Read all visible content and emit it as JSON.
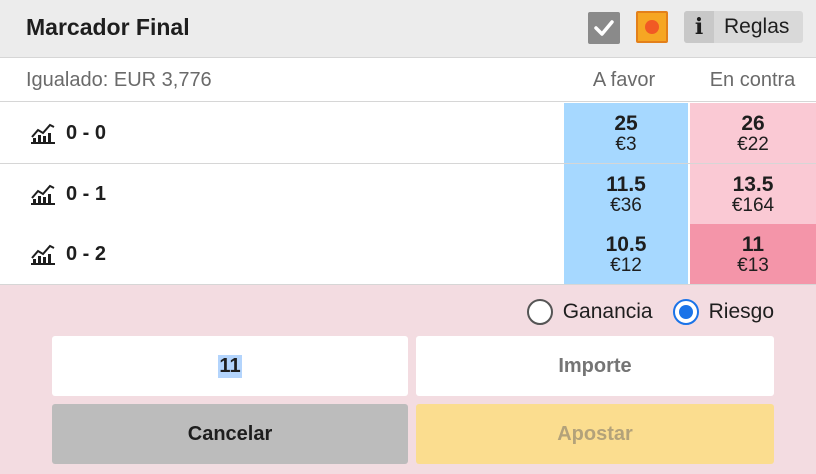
{
  "market": {
    "title": "Marcador Final",
    "rules_label": "Reglas",
    "info_label": "i"
  },
  "summary": {
    "matched": "Igualado: EUR 3,776",
    "back_header": "A favor",
    "lay_header": "En contra"
  },
  "runners": [
    {
      "name": "0 - 0",
      "back_odds": "25",
      "back_stake": "€3",
      "lay_odds": "26",
      "lay_stake": "€22"
    },
    {
      "name": "0 - 1",
      "back_odds": "11.5",
      "back_stake": "€36",
      "lay_odds": "13.5",
      "lay_stake": "€164"
    },
    {
      "name": "0 - 2",
      "back_odds": "10.5",
      "back_stake": "€12",
      "lay_odds": "11",
      "lay_stake": "€13"
    }
  ],
  "betslip": {
    "radio_profit": "Ganancia",
    "radio_risk": "Riesgo",
    "selected_radio": "Riesgo",
    "odds_value": "11",
    "stake_placeholder": "Importe",
    "cancel_label": "Cancelar",
    "place_label": "Apostar"
  },
  "colors": {
    "back": "#a6d8ff",
    "lay": "#fac9d4",
    "lay_selected": "#f495a9",
    "betslip_bg": "#f3dce1",
    "place_button": "#fbdd8f"
  },
  "icons": {
    "header_toggle_1": "check-icon",
    "header_toggle_2": "live-dot-icon",
    "runner_icon": "chart-icon"
  }
}
